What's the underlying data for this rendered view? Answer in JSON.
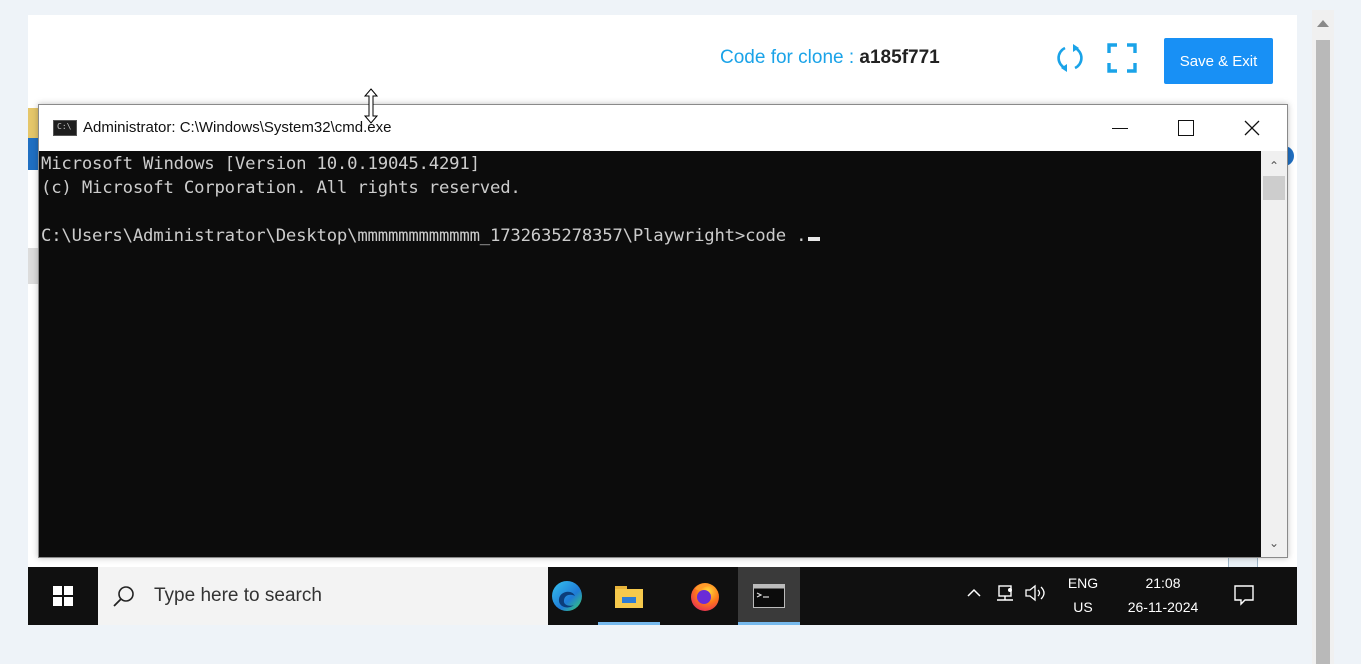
{
  "header": {
    "code_label": "Code for clone :",
    "code_value": "a185f771",
    "save_label": "Save & Exit",
    "accent_color": "#1aa3e8"
  },
  "cmd": {
    "title": "Administrator: C:\\Windows\\System32\\cmd.exe",
    "icon_text": "C:\\",
    "lines": [
      "Microsoft Windows [Version 10.0.19045.4291]",
      "(c) Microsoft Corporation. All rights reserved.",
      "",
      "C:\\Users\\Administrator\\Desktop\\mmmmmmmmmmmm_1732635278357\\Playwright>code ."
    ]
  },
  "taskbar": {
    "search_placeholder": "Type here to search",
    "apps": [
      "edge-icon",
      "file-explorer-icon",
      "firefox-icon",
      "cmd-icon"
    ],
    "lang": "ENG",
    "region": "US",
    "time": "21:08",
    "date": "26-11-2024"
  }
}
